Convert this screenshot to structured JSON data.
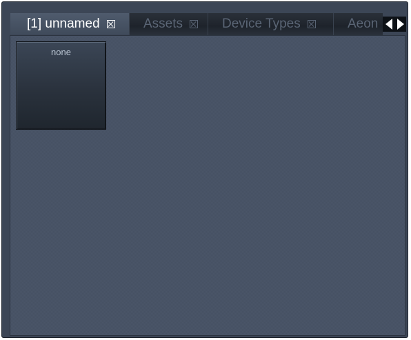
{
  "tabs": [
    {
      "label": "[1] unnamed",
      "active": true
    },
    {
      "label": "Assets",
      "active": false
    },
    {
      "label": "Device Types",
      "active": false
    },
    {
      "label": "Aeon",
      "active": false
    }
  ],
  "icons": {
    "tab_close": "close-box-icon",
    "scroll_left": "triangle-left-icon",
    "scroll_right": "triangle-right-icon"
  },
  "grid": {
    "cells": [
      {
        "label": "none"
      }
    ]
  },
  "colors": {
    "panel_background": "#4a5568",
    "frame": "#3c4656",
    "active_tab_text": "#ffffff",
    "inactive_tab_text": "#5a6575",
    "cell_label": "#b8c3d0"
  }
}
